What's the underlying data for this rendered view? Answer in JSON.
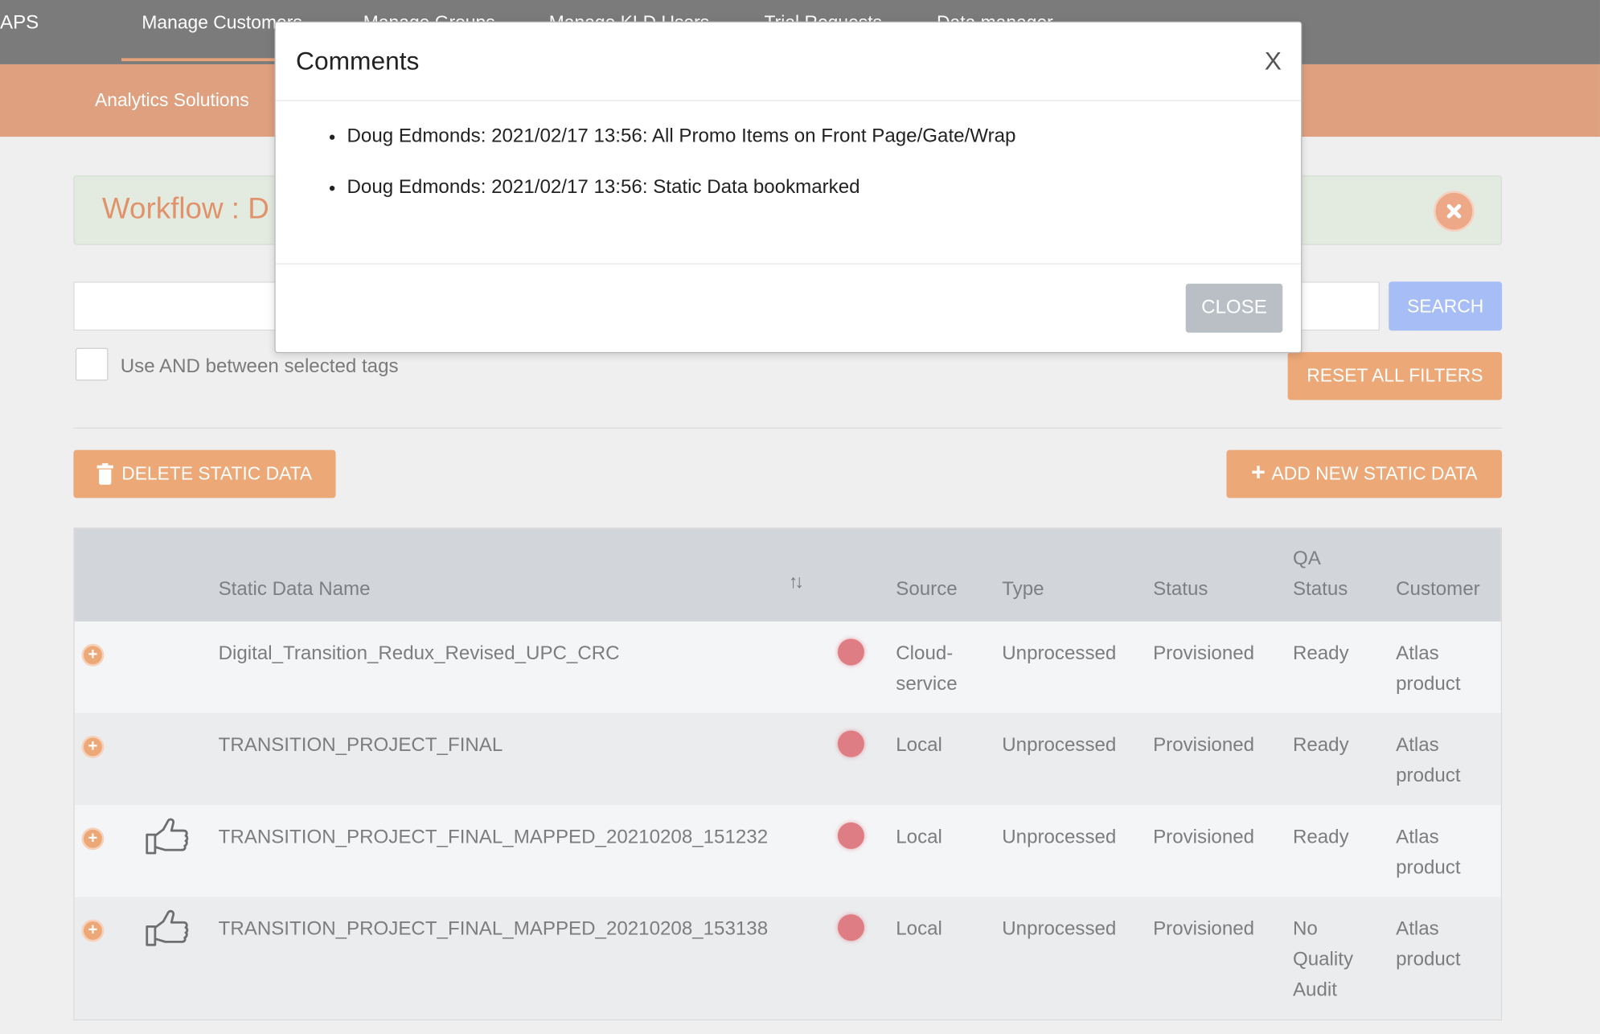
{
  "top_nav": {
    "brand": "APS",
    "items": [
      "Manage Customers",
      "Manage Groups",
      "Manage KLD Users",
      "Trial Requests",
      "Data manager"
    ]
  },
  "sub_nav": {
    "item": "Analytics Solutions"
  },
  "workflow": {
    "title": "Workflow : D"
  },
  "filters": {
    "search_button": "SEARCH",
    "reset_button": "RESET ALL FILTERS",
    "and_label": "Use AND between selected tags"
  },
  "actions": {
    "delete_button": "DELETE STATIC DATA",
    "add_button": "ADD NEW STATIC DATA"
  },
  "table": {
    "headers": {
      "name": "Static Data Name",
      "source": "Source",
      "type": "Type",
      "status": "Status",
      "qa_status_line1": "QA",
      "qa_status_line2": "Status",
      "customer": "Customer"
    },
    "rows": [
      {
        "name": "Digital_Transition_Redux_Revised_UPC_CRC",
        "source": [
          "Cloud-",
          "service"
        ],
        "type": "Unprocessed",
        "status": "Provisioned",
        "qa": [
          "Ready"
        ],
        "customer": [
          "Atlas",
          "product"
        ]
      },
      {
        "name": "TRANSITION_PROJECT_FINAL",
        "source": [
          "Local"
        ],
        "type": "Unprocessed",
        "status": "Provisioned",
        "qa": [
          "Ready"
        ],
        "customer": [
          "Atlas",
          "product"
        ]
      },
      {
        "name": "TRANSITION_PROJECT_FINAL_MAPPED_20210208_151232",
        "source": [
          "Local"
        ],
        "type": "Unprocessed",
        "status": "Provisioned",
        "qa": [
          "Ready"
        ],
        "customer": [
          "Atlas",
          "product"
        ]
      },
      {
        "name": "TRANSITION_PROJECT_FINAL_MAPPED_20210208_153138",
        "source": [
          "Local"
        ],
        "type": "Unprocessed",
        "status": "Provisioned",
        "qa": [
          "No",
          "Quality",
          "Audit"
        ],
        "customer": [
          "Atlas",
          "product"
        ]
      }
    ]
  },
  "modal": {
    "title": "Comments",
    "close_x": "X",
    "comments": [
      "Doug Edmonds: 2021/02/17 13:56: All Promo Items on Front Page/Gate/Wrap",
      "Doug Edmonds: 2021/02/17 13:56: Static Data bookmarked"
    ],
    "close_button": "CLOSE"
  },
  "colors": {
    "top_nav": "#7b7b7b",
    "sub_nav": "#dfa07f",
    "accent": "#eda877",
    "search": "#a6bdf6",
    "status_dot": "#de7e84"
  }
}
